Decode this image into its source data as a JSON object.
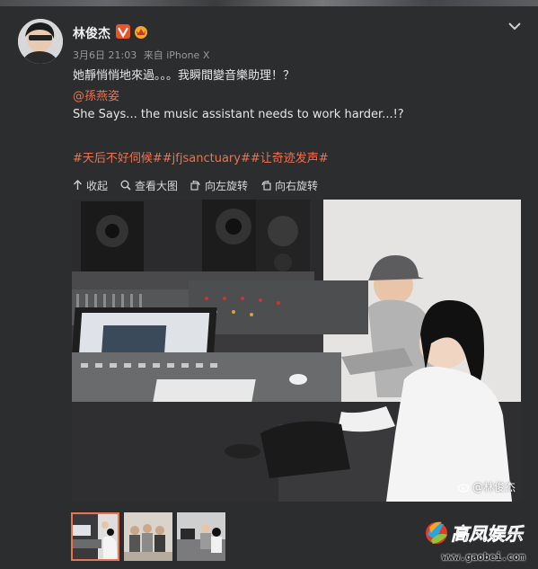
{
  "post": {
    "author": "林俊杰",
    "date": "3月6日 21:03",
    "source": "来自 iPhone X",
    "text_line1": "她靜悄悄地來過。。。我瞬間變音樂助理！？",
    "mention": "@孫燕姿",
    "text_line3": "She Says... the music assistant needs to work harder...!?",
    "hashtags": "#天后不好伺候##jfjsanctuary##让奇迹发声#"
  },
  "toolbar": {
    "collapse_label": "收起",
    "view_large_label": "查看大图",
    "rotate_left_label": "向左旋转",
    "rotate_right_label": "向右旋转"
  },
  "photo": {
    "watermark": "@林俊杰"
  },
  "thumbnails": {
    "count": 3,
    "active_index": 0
  },
  "site_logo": {
    "brand": "高凤娱乐",
    "url": "www.gaobei.com"
  },
  "colors": {
    "background": "#2c2d2f",
    "accent": "#eb7350",
    "verified_badge": "#e8532c",
    "muted_text": "#999999"
  },
  "icons": {
    "collapse": "arrow-up-icon",
    "view_large": "magnifier-icon",
    "rotate_left": "rotate-left-icon",
    "rotate_right": "rotate-right-icon",
    "more": "chevron-down-icon"
  }
}
